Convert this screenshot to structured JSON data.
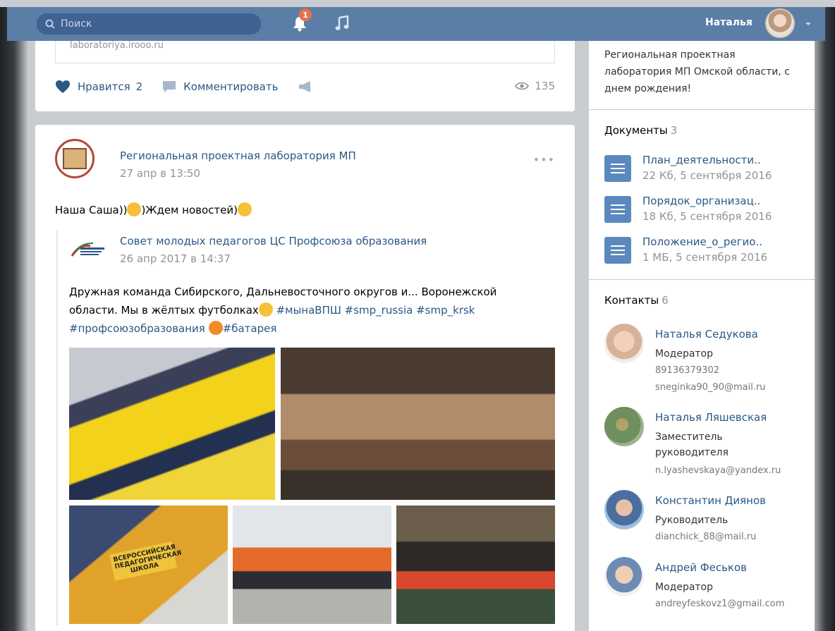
{
  "header": {
    "search_placeholder": "Поиск",
    "notifications_count": "1",
    "user_name": "Наталья"
  },
  "post1": {
    "link_text": "laboratoriya.irooo.ru",
    "like_label": "Нравится",
    "like_count": "2",
    "comment_label": "Комментировать",
    "views": "135"
  },
  "post2": {
    "author": "Региональная проектная лаборатория МП",
    "date": "27 апр в 13:50",
    "text_part1": "Наша Саша))",
    "text_part2": ")Ждем новостей)",
    "repost": {
      "author": "Совет молодых педагогов ЦС Профсоюза образования",
      "date": "26 апр 2017 в 14:37",
      "text_line1": "Дружная команда Сибирского, Дальневосточного округов и... Воронежской",
      "text_line2": "области. Мы в жёлтых футболках",
      "tags_line2": "#мынаВПШ #smp_russia #smp_krsk",
      "tags_line3a": "#профсоюзобразования",
      "tags_line3b": "#батарея"
    },
    "photo_label": "ВСЕРОССИЙСКАЯ ПЕДАГОГИЧЕСКАЯ ШКОЛА"
  },
  "sidebar": {
    "greeting": "Региональная проектная лаборатория МП Омской области, с днем рождения!",
    "documents_title": "Документы",
    "documents_count": "3",
    "documents": [
      {
        "name": "План_деятельности..",
        "meta": "22 Кб, 5 сентября 2016"
      },
      {
        "name": "Порядок_организац..",
        "meta": "18 Кб, 5 сентября 2016"
      },
      {
        "name": "Положение_о_регио..",
        "meta": "1 МБ, 5 сентября 2016"
      }
    ],
    "contacts_title": "Контакты",
    "contacts_count": "6",
    "contacts": [
      {
        "name": "Наталья Седукова",
        "role": "Модератор",
        "phone": "89136379302",
        "email": "sneginka90_90@mail.ru"
      },
      {
        "name": "Наталья Ляшевская",
        "role": "Заместитель руководителя",
        "email": "n.lyashevskaya@yandex.ru"
      },
      {
        "name": "Константин Диянов",
        "role": "Руководитель",
        "email": "dianchick_88@mail.ru"
      },
      {
        "name": "Андрей Феськов",
        "role": "Модератор",
        "email": "andreyfeskovz1@gmail.com"
      }
    ]
  },
  "colors": {
    "header_bg": "#5b7ea6",
    "link": "#2a5885",
    "badge": "#e8704a",
    "doc_icon": "#5b88bd"
  }
}
